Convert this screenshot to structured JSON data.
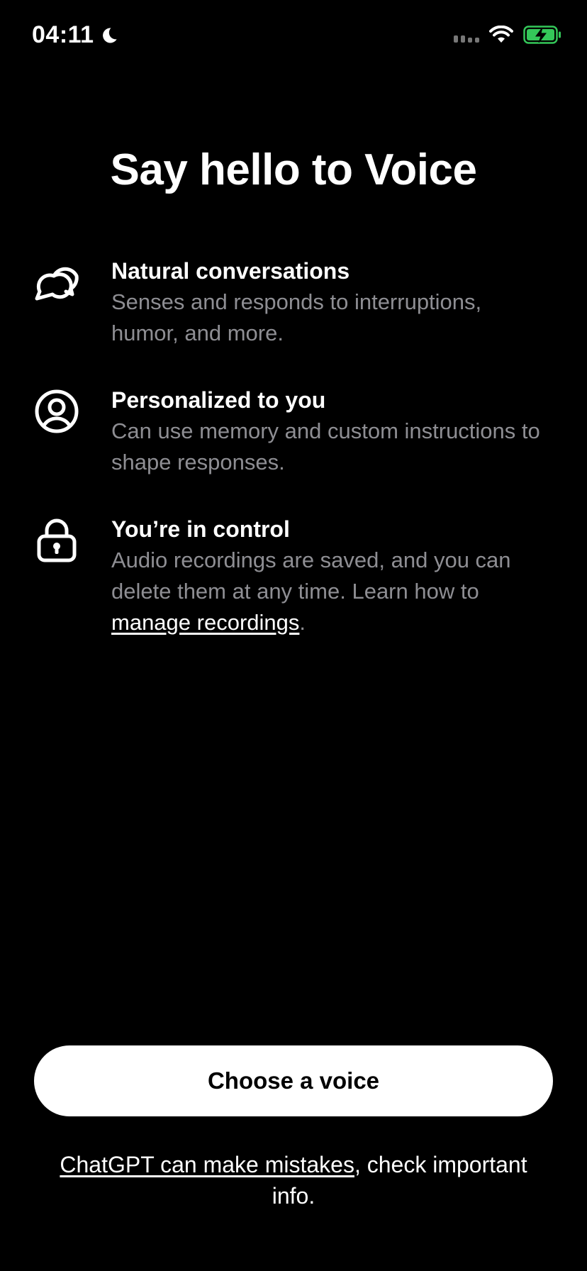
{
  "status_bar": {
    "time": "04:11",
    "icons": [
      "moon-icon",
      "signal-icon",
      "wifi-icon",
      "battery-charging-icon"
    ],
    "battery_color": "#34c759"
  },
  "title": "Say hello to Voice",
  "features": [
    {
      "icon": "chat-bubbles-icon",
      "title": "Natural conversations",
      "description": "Senses and responds to interruptions, humor, and more."
    },
    {
      "icon": "user-circle-icon",
      "title": "Personalized to you",
      "description": "Can use memory and custom instructions to shape responses."
    },
    {
      "icon": "lock-icon",
      "title": "You’re in control",
      "description_prefix": "Audio recordings are saved, and you can delete them at any time. Learn how to ",
      "link_text": "manage recordings",
      "description_suffix": "."
    }
  ],
  "primary_button": {
    "label": "Choose a voice"
  },
  "disclaimer": {
    "link_text": "ChatGPT can make mistakes",
    "text": ", check important info."
  },
  "colors": {
    "background": "#000000",
    "primary_text": "#ffffff",
    "secondary_text": "#8e8e93",
    "button_background": "#ffffff",
    "button_text": "#000000"
  }
}
